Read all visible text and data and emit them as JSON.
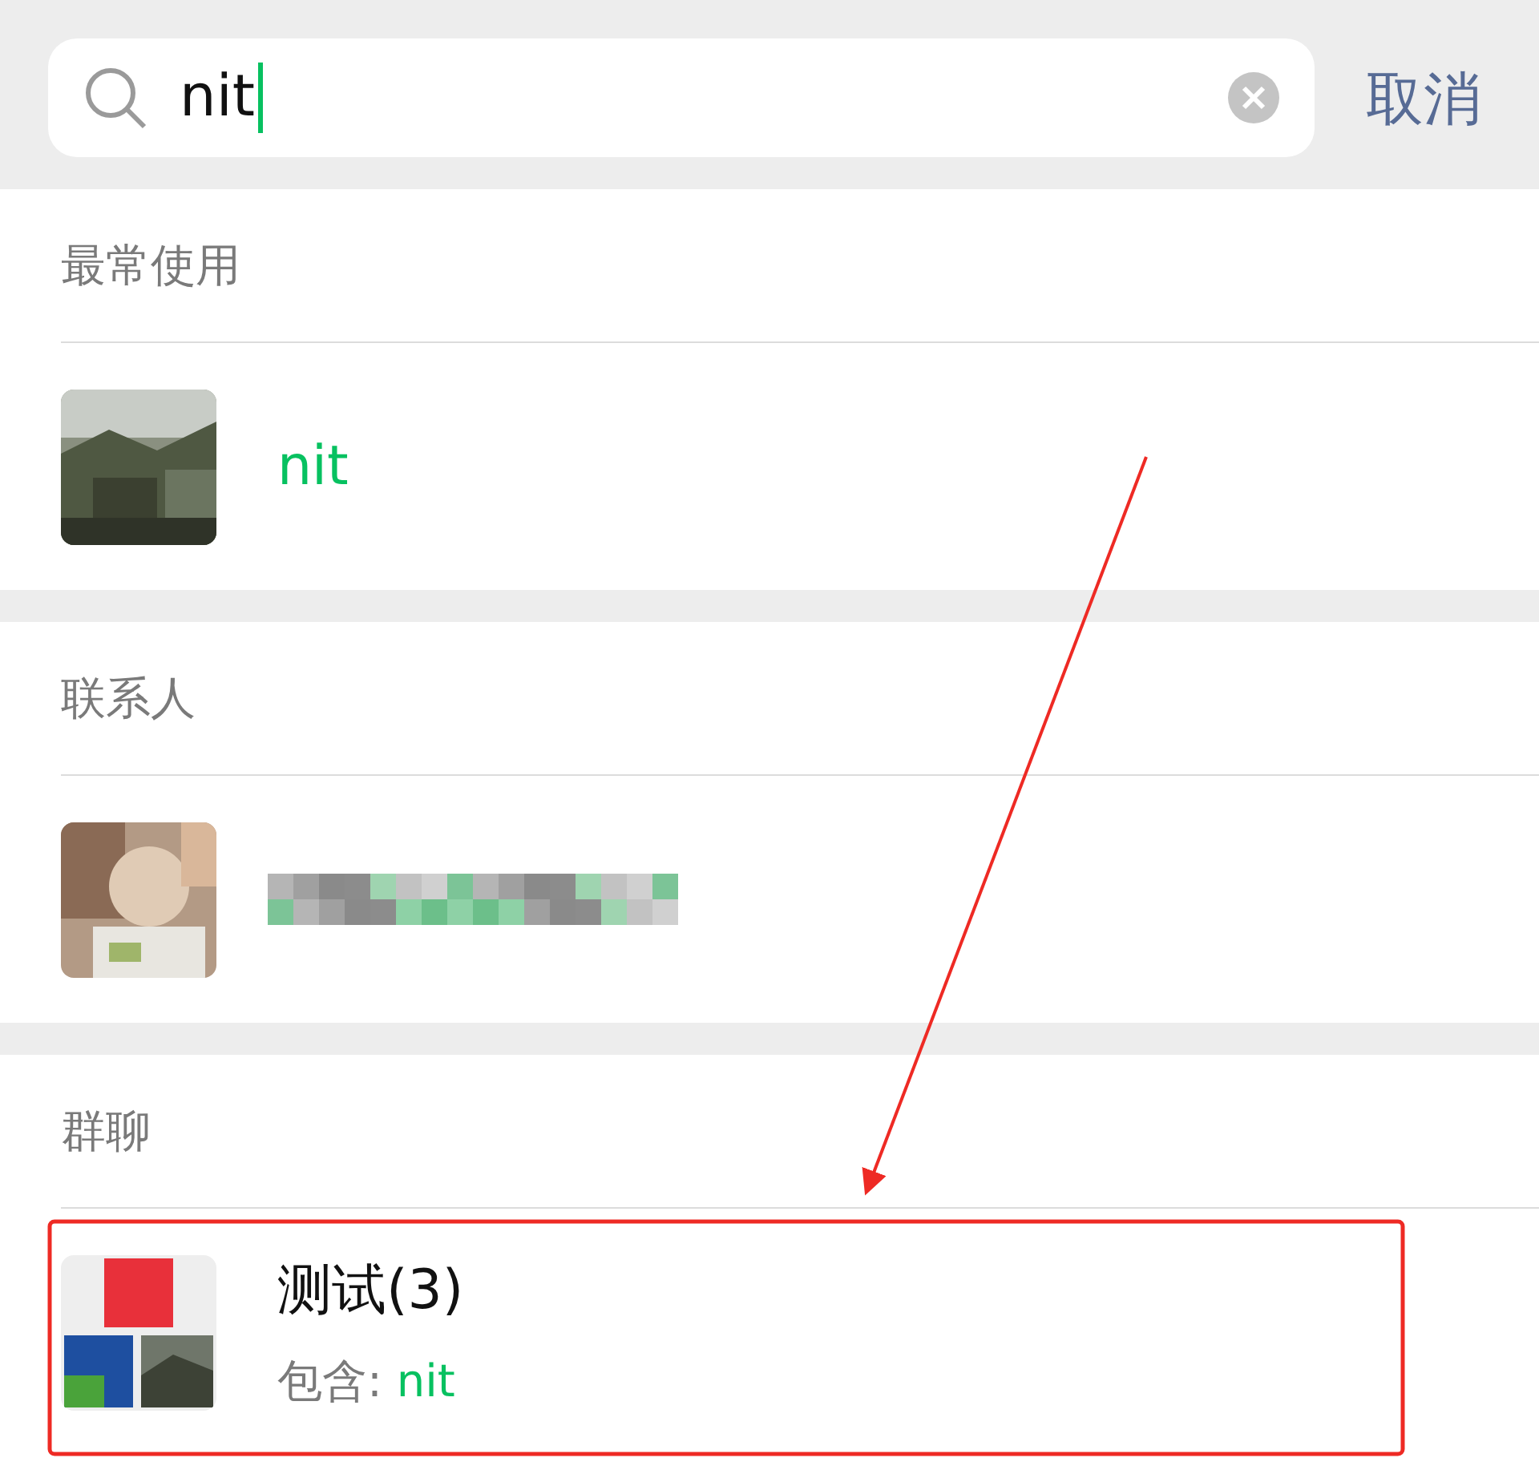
{
  "search": {
    "value": "nit",
    "cursor": true
  },
  "cancel": "取消",
  "sections": [
    {
      "title": "最常使用",
      "items": [
        {
          "kind": "contact",
          "name": "nit",
          "highlighted": true
        }
      ]
    },
    {
      "title": "联系人",
      "items": [
        {
          "kind": "redacted"
        }
      ]
    },
    {
      "title": "群聊",
      "items": [
        {
          "kind": "group",
          "name": "测试(3)",
          "detail_label": "包含: ",
          "detail_match": "nit"
        }
      ]
    }
  ],
  "annotation": {
    "arrow": true,
    "highlight_box": true
  }
}
